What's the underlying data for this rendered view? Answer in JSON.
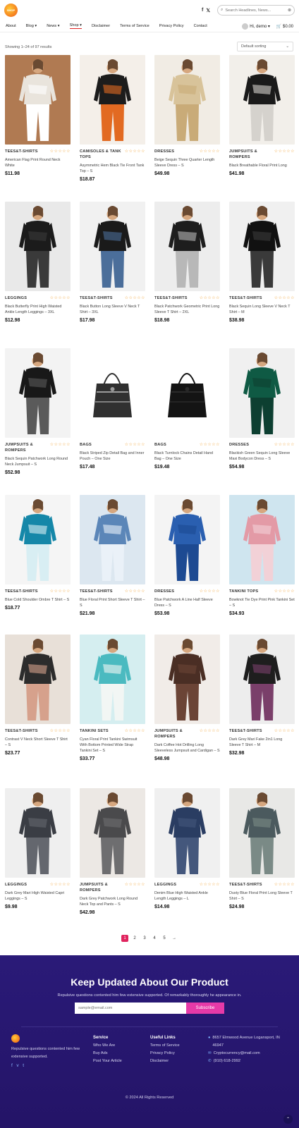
{
  "header": {
    "logo_text": "SHOP",
    "social": [
      "f",
      "𝕏"
    ],
    "search_placeholder": "Search Headlines, News...",
    "search_icon": "search-icon",
    "close_icon": "close-icon"
  },
  "nav": {
    "items": [
      {
        "label": "About",
        "caret": ""
      },
      {
        "label": "Blog ▾",
        "caret": ""
      },
      {
        "label": "News ▾",
        "caret": ""
      },
      {
        "label": "Shop ▾",
        "caret": ""
      },
      {
        "label": "Disclaimer",
        "caret": ""
      },
      {
        "label": "Terms of Service",
        "caret": ""
      },
      {
        "label": "Privacy Policy",
        "caret": ""
      },
      {
        "label": "Contact",
        "caret": ""
      }
    ],
    "greeting": "Hi, demo ▾",
    "cart_total": "$0.00",
    "cart_count": "0"
  },
  "shop": {
    "results": "Showing 1–24 of 97 results",
    "sort": "Default sorting"
  },
  "products": [
    {
      "cat": "TEES&T-SHIRTS",
      "title": "American Flag Print Round Neck White",
      "price": "$11.98"
    },
    {
      "cat": "CAMISOLES & TANK TOPS",
      "title": "Asymmetric Hem Black Tie Front Tank Top – S",
      "price": "$18.87"
    },
    {
      "cat": "DRESSES",
      "title": "Beige Sequin Three Quarter Length Sleeve Dress – S",
      "price": "$49.98"
    },
    {
      "cat": "JUMPSUITS & ROMPERS",
      "title": "Black Breathable Floral Print Long",
      "price": "$41.98"
    },
    {
      "cat": "LEGGINGS",
      "title": "Black Butterfly Print High Waisted Ankle Length Leggings – 3XL",
      "price": "$12.98"
    },
    {
      "cat": "TEES&T-SHIRTS",
      "title": "Black Button Long Sleeve V Neck T Shirt – 3XL",
      "price": "$17.98"
    },
    {
      "cat": "TEES&T-SHIRTS",
      "title": "Black Patchwork Geometric Print Long Sleeve T Shirt – 2XL",
      "price": "$18.98"
    },
    {
      "cat": "TEES&T-SHIRTS",
      "title": "Black Sequin Long Sleeve V Neck T Shirt – M",
      "price": "$38.98"
    },
    {
      "cat": "JUMPSUITS & ROMPERS",
      "title": "Black Sequin Patchwork Long Round Neck Jumpsuit – S",
      "price": "$52.98"
    },
    {
      "cat": "BAGS",
      "title": "Black Striped Zip Detail Bag and Inner Pouch – One Size",
      "price": "$17.48"
    },
    {
      "cat": "BAGS",
      "title": "Black Turnlock Chains Detail Hand Bag – One Size",
      "price": "$19.48"
    },
    {
      "cat": "DRESSES",
      "title": "Blackish Green Sequin Long Sleeve Maxi Bodycon Dress – S",
      "price": "$54.98"
    },
    {
      "cat": "TEES&T-SHIRTS",
      "title": "Blue Cold Shoulder Ombre T Shirt – S",
      "price": "$18.77"
    },
    {
      "cat": "TEES&T-SHIRTS",
      "title": "Blue Floral Print Short Sleeve T Shirt – S",
      "price": "$21.98"
    },
    {
      "cat": "DRESSES",
      "title": "Blue Patchwork A Line Half Sleeve Dress – S",
      "price": "$53.98"
    },
    {
      "cat": "TANKINI TOPS",
      "title": "Bowknot Tie Dye Print Pink Tankini Set – S",
      "price": "$34.93"
    },
    {
      "cat": "TEES&T-SHIRTS",
      "title": "Contrast V Neck Short Sleeve T Shirt – S",
      "price": "$23.77"
    },
    {
      "cat": "TANKINI SETS",
      "title": "Cyan Floral Print Tankini Swimsuit With Bottom Printed Wide Strap Tankini Set – S",
      "price": "$33.77"
    },
    {
      "cat": "JUMPSUITS & ROMPERS",
      "title": "Dark Coffee Hot Drilling Long Sleeveless Jumpsuit and Cardigan – S",
      "price": "$48.98"
    },
    {
      "cat": "TEES&T-SHIRTS",
      "title": "Dark Grey Mari Fake 2in1 Long Sleeve T Shirt – M",
      "price": "$32.98"
    },
    {
      "cat": "LEGGINGS",
      "title": "Dark Grey Mari High Waisted Capri Leggings – S",
      "price": "$9.98"
    },
    {
      "cat": "JUMPSUITS & ROMPERS",
      "title": "Dark Grey Patchwork Long Round Neck Top and Pants – S",
      "price": "$42.98"
    },
    {
      "cat": "LEGGINGS",
      "title": "Denim Blue High Waisted Ankle Length Leggings – L",
      "price": "$14.98"
    },
    {
      "cat": "TEES&T-SHIRTS",
      "title": "Dusty Blue Floral Print Long Sleeve T Shirt – S",
      "price": "$24.98"
    }
  ],
  "stars": "☆☆☆☆☆",
  "pagination": [
    "1",
    "2",
    "3",
    "4",
    "5",
    "→"
  ],
  "footer": {
    "heading": "Keep Updated About Our Product",
    "sub": "Repulsive questions contented him few extensive supported. Of remarkably thoroughly he appearance in.",
    "email_placeholder": "sample@email.com",
    "subscribe": "Subscribe",
    "about": "Repulsive questions contented him few extensive supported.",
    "service_h": "Service",
    "service": [
      "Who We Are",
      "Buy Ads",
      "Post Your Article"
    ],
    "links_h": "Useful Links",
    "links": [
      "Terms of Service",
      "Privacy Policy",
      "Disclaimer"
    ],
    "address": "8657 Elmwood Avenue Logansport, IN 46947",
    "email": "Cryptocurrency@mail.com",
    "phone": "(910) 618-2992",
    "copyright": "© 2024 All Rights Reserved",
    "socials": [
      "f",
      "v",
      "t"
    ]
  }
}
